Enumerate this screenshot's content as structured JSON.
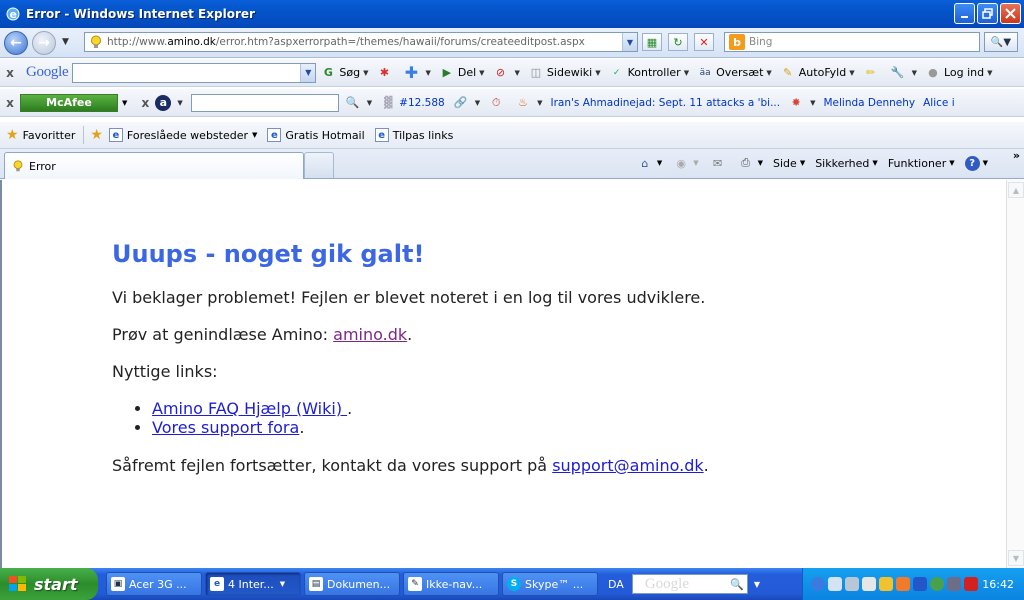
{
  "window": {
    "title": "Error - Windows Internet Explorer"
  },
  "address_bar": {
    "url_prefix": "http://www.",
    "url_domain": "amino.dk",
    "url_rest": "/error.htm?aspxerrorpath=/themes/hawaii/forums/createeditpost.aspx",
    "search_placeholder": "Bing"
  },
  "google_toolbar": {
    "logo": "Google",
    "items": [
      {
        "label": "Søg"
      },
      {
        "label": "Del"
      },
      {
        "label": "Sidewiki"
      },
      {
        "label": "Kontroller"
      },
      {
        "label": "Oversæt"
      },
      {
        "label": "AutoFyld"
      },
      {
        "label": "Log ind"
      }
    ]
  },
  "mcafee_toolbar": {
    "badge": "McAfee",
    "count": "#12.588",
    "ticker1": "Iran's Ahmadinejad: Sept. 11 attacks a 'bi...",
    "ticker2": "Melinda Dennehy",
    "ticker3": "Alice i"
  },
  "favorites_bar": {
    "favorites": "Favoritter",
    "links": [
      {
        "label": "Foreslåede websteder"
      },
      {
        "label": "Gratis Hotmail"
      },
      {
        "label": "Tilpas links"
      }
    ]
  },
  "tabs": [
    {
      "label": "Error"
    }
  ],
  "command_bar": {
    "items": [
      {
        "label": "Side"
      },
      {
        "label": "Sikkerhed"
      },
      {
        "label": "Funktioner"
      }
    ]
  },
  "page": {
    "heading": "Uuups - noget gik galt!",
    "apology": "Vi beklager problemet! Fejlen er blevet noteret i en log til vores udviklere.",
    "reload_prefix": "Prøv at genindlæse Amino: ",
    "reload_link": "amino.dk",
    "reload_suffix": ".",
    "links_heading": "Nyttige links:",
    "useful_links": [
      {
        "label": "Amino FAQ Hjælp (Wiki) ",
        "suffix": "."
      },
      {
        "label": "Vores support fora",
        "suffix": "."
      }
    ],
    "contact_prefix": "Såfremt fejlen fortsætter, kontakt da vores support på ",
    "contact_link": "support@amino.dk",
    "contact_suffix": "."
  },
  "taskbar": {
    "start_label": "start",
    "tasks": [
      {
        "label": "Acer 3G ..."
      },
      {
        "label": "4 Inter..."
      },
      {
        "label": "Dokumen..."
      },
      {
        "label": "Ikke-nav..."
      },
      {
        "label": "Skype™ ..."
      }
    ],
    "language": "DA",
    "desktop_search_logo": "Google",
    "clock": "16:42"
  },
  "colors": {
    "heading": "#3b67e5",
    "link": "#1d1dd6",
    "visited_link": "#80248a",
    "titlebar": "#0453c9"
  }
}
